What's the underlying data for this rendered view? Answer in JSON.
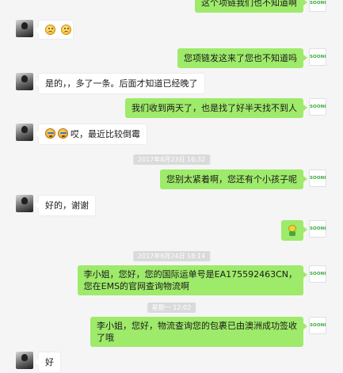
{
  "brand": {
    "avatar_text": "SOONFUN",
    "accent": "#9eea6a"
  },
  "messages": [
    {
      "text": "这个项链我们也不知道啊"
    },
    {
      "emojis": [
        "sad-face",
        "sad-face"
      ]
    },
    {
      "text": "您项链发这来了您也不知道吗"
    },
    {
      "text": "是的，，多了一条。后面才知道已经晚了"
    },
    {
      "text": "我们收到两天了，也是找了好半天找不到人"
    },
    {
      "text": "哎，最近比较倒霉"
    },
    {
      "timestamp": "2017年8月23日 16:32"
    },
    {
      "text": "您别太紧着啊，您还有个小孩子呢"
    },
    {
      "text": "好的，谢谢"
    },
    {
      "sticker": "green-creature-sticker"
    },
    {
      "timestamp": "2017年8月24日 18:14"
    },
    {
      "line1": "李小姐，您好，您的国际运单号是EA175592463CN，",
      "line2": "您在EMS的官网查询物流啊"
    },
    {
      "timestamp": "星期一 12:02"
    },
    {
      "line1": "李小姐，您好，物流查询您的包裹已由澳洲成功签收",
      "line2": "了哦"
    },
    {
      "text": "好"
    }
  ]
}
